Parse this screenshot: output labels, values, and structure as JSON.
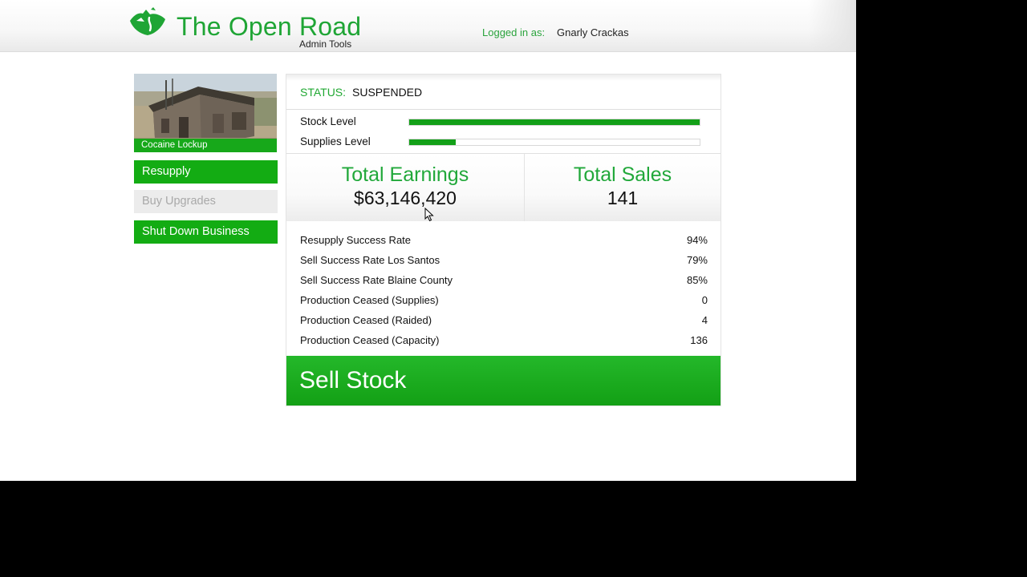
{
  "header": {
    "title": "The Open Road",
    "subtitle": "Admin Tools",
    "logged_in_label": "Logged in as:",
    "user_name": "Gnarly Crackas"
  },
  "business": {
    "name": "Cocaine Lockup"
  },
  "sidebar": {
    "buttons": [
      {
        "label": "Resupply",
        "enabled": true
      },
      {
        "label": "Buy Upgrades",
        "enabled": false
      },
      {
        "label": "Shut Down Business",
        "enabled": true
      }
    ]
  },
  "status": {
    "label": "STATUS:",
    "value": "SUSPENDED"
  },
  "levels": [
    {
      "label": "Stock Level",
      "fraction": 1.0
    },
    {
      "label": "Supplies Level",
      "fraction": 0.16
    }
  ],
  "stats": {
    "earnings_title": "Total Earnings",
    "earnings_value": "$63,146,420",
    "sales_title": "Total Sales",
    "sales_value": "141"
  },
  "rates": [
    {
      "name": "Resupply Success Rate",
      "value": "94%"
    },
    {
      "name": "Sell Success Rate Los Santos",
      "value": "79%"
    },
    {
      "name": "Sell Success Rate Blaine County",
      "value": "85%"
    },
    {
      "name": "Production Ceased (Supplies)",
      "value": "0"
    },
    {
      "name": "Production Ceased (Raided)",
      "value": "4"
    },
    {
      "name": "Production Ceased (Capacity)",
      "value": "136"
    }
  ],
  "sell_button": {
    "label": "Sell Stock"
  },
  "colors": {
    "brand_green": "#1fa535",
    "button_green": "#13ac13",
    "disabled_gray": "#ececec"
  }
}
